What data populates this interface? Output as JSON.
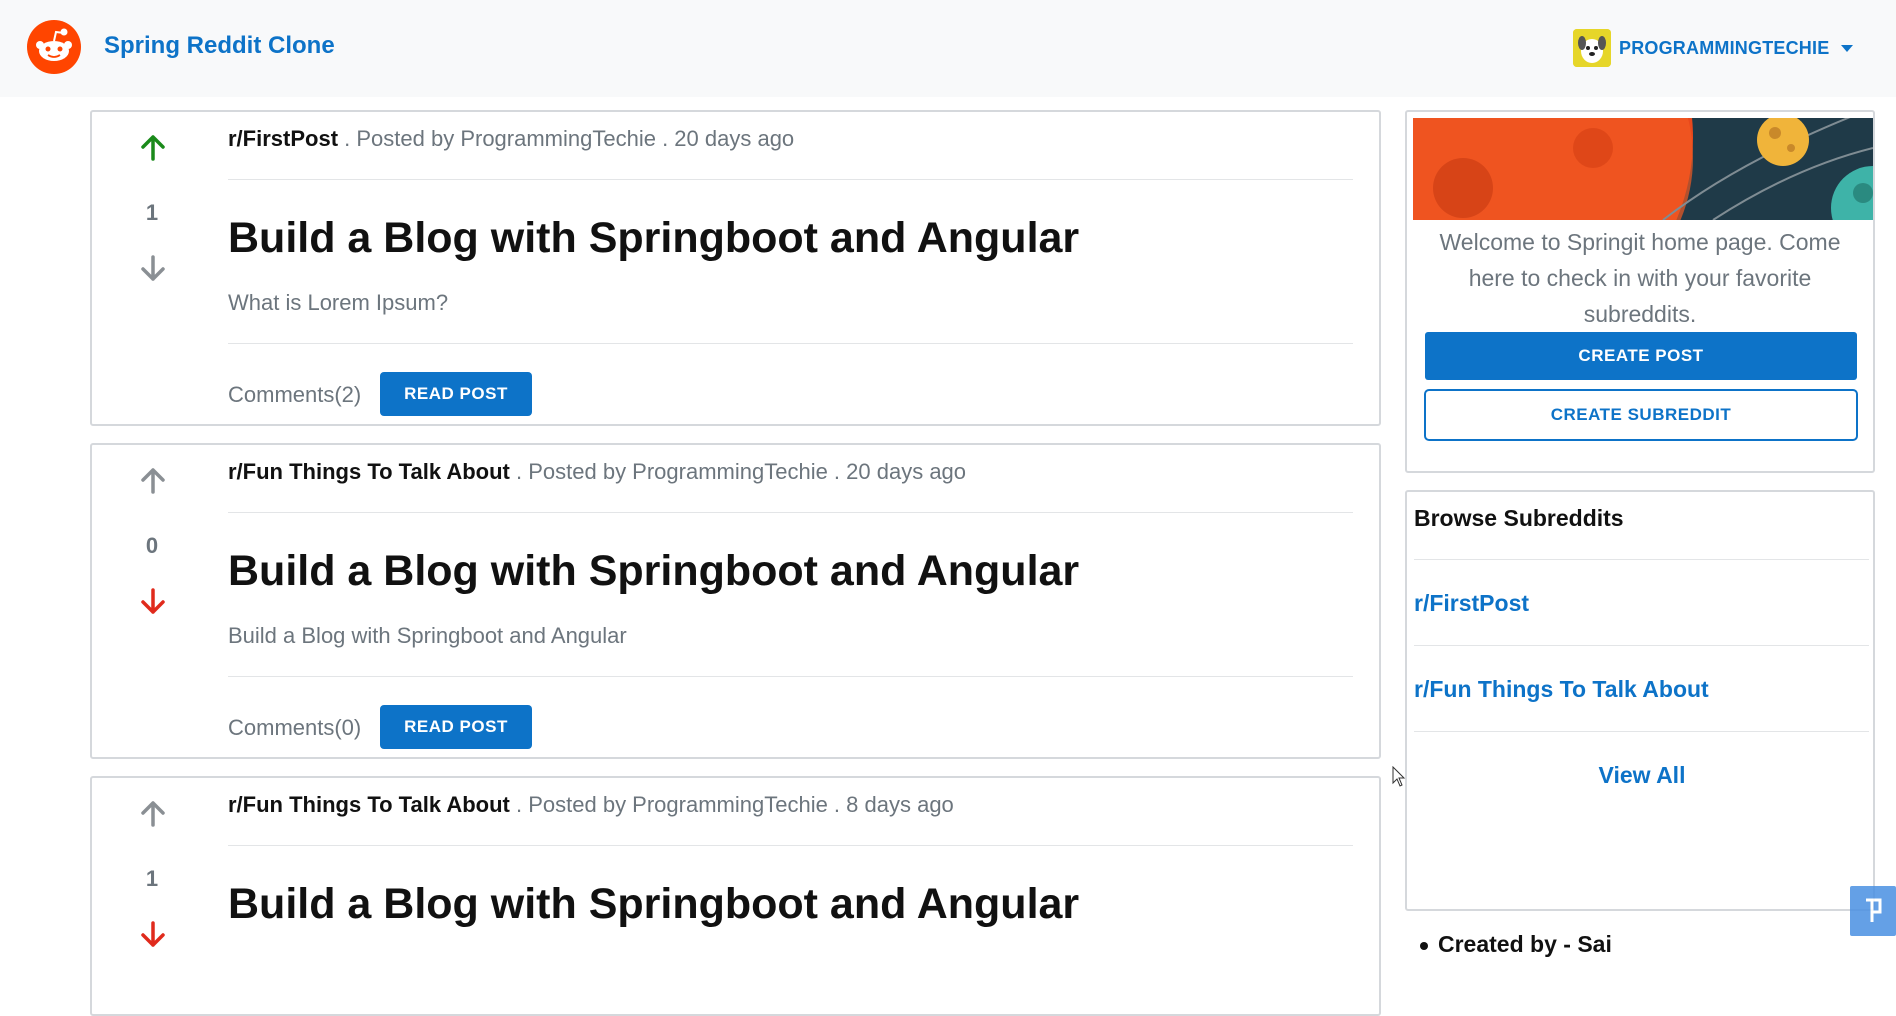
{
  "navbar": {
    "brand": "Spring Reddit Clone",
    "username": "PROGRAMMINGTECHIE"
  },
  "posts": [
    {
      "subreddit": "r/FirstPost",
      "meta": " . Posted by ProgrammingTechie . 20 days ago",
      "votes": "1",
      "vote_state": "up",
      "title": "Build a Blog with Springboot and Angular",
      "description": "What is Lorem Ipsum?",
      "comments": "Comments(2)",
      "button": "READ POST"
    },
    {
      "subreddit": "r/Fun Things To Talk About",
      "meta": " . Posted by ProgrammingTechie . 20 days ago",
      "votes": "0",
      "vote_state": "down",
      "title": "Build a Blog with Springboot and Angular",
      "description": "Build a Blog with Springboot and Angular",
      "comments": "Comments(0)",
      "button": "READ POST"
    },
    {
      "subreddit": "r/Fun Things To Talk About",
      "meta": " . Posted by ProgrammingTechie . 8 days ago",
      "votes": "1",
      "vote_state": "down",
      "title": "Build a Blog with Springboot and Angular",
      "description": "",
      "comments": "",
      "button": ""
    }
  ],
  "sidebar": {
    "welcome": "Welcome to Springit home page. Come here to check in with your favorite subreddits.",
    "create_post": "CREATE POST",
    "create_subreddit": "CREATE SUBREDDIT",
    "browse_title": "Browse Subreddits",
    "subreddits": [
      "r/FirstPost",
      "r/Fun Things To Talk About"
    ],
    "view_all": "View All"
  },
  "footer": {
    "credit": "Created by - Sai"
  },
  "colors": {
    "brand": "#0d73c8",
    "reddit_orange": "#ff4500",
    "upvote_active": "#1a8a1a",
    "downvote_active": "#e02a1c",
    "vote_inactive": "#8a8f94"
  }
}
